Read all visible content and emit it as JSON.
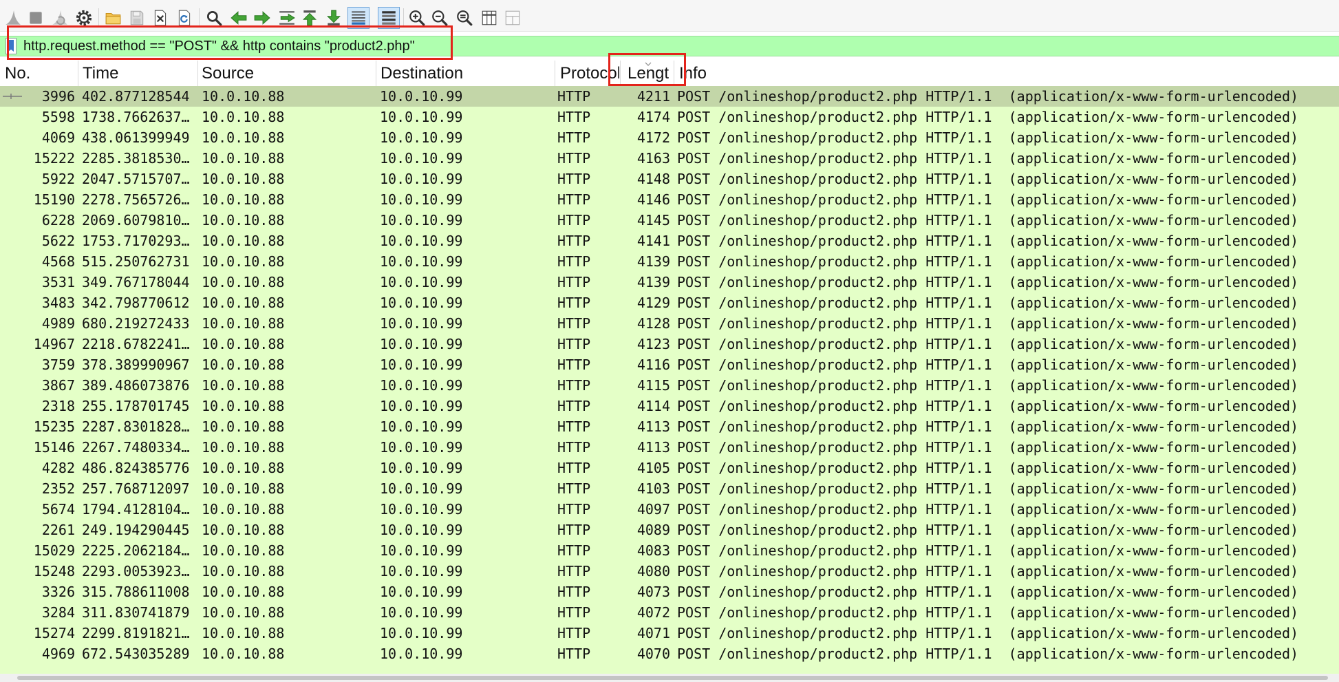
{
  "toolbar": {
    "buttons": [
      {
        "icon": "shark-fin-icon",
        "enabled": false
      },
      {
        "icon": "stop-icon",
        "enabled": false
      },
      {
        "icon": "restart-capture-icon",
        "enabled": false
      },
      {
        "icon": "capture-options-icon",
        "enabled": true
      },
      {
        "icon": "open-folder-icon",
        "enabled": true
      },
      {
        "icon": "save-icon",
        "enabled": false
      },
      {
        "icon": "close-file-icon",
        "enabled": true
      },
      {
        "icon": "reload-icon",
        "enabled": true
      },
      {
        "icon": "search-icon",
        "enabled": true
      },
      {
        "icon": "go-back-icon",
        "enabled": true
      },
      {
        "icon": "go-forward-icon",
        "enabled": true
      },
      {
        "icon": "go-to-packet-icon",
        "enabled": true
      },
      {
        "icon": "go-first-icon",
        "enabled": true
      },
      {
        "icon": "go-last-icon",
        "enabled": true
      },
      {
        "icon": "autoscroll-icon",
        "enabled": true,
        "checked": true
      },
      {
        "icon": "colorize-icon",
        "enabled": true,
        "checked": true
      },
      {
        "icon": "zoom-in-icon",
        "enabled": true
      },
      {
        "icon": "zoom-out-icon",
        "enabled": true
      },
      {
        "icon": "zoom-reset-icon",
        "enabled": true
      },
      {
        "icon": "resize-columns-icon",
        "enabled": true
      },
      {
        "icon": "layout-icon",
        "enabled": false
      }
    ]
  },
  "display_filter": {
    "value": "http.request.method == \"POST\" && http contains \"product2.php\"",
    "bookmark_icon": "bookmark-icon"
  },
  "columns": {
    "no": "No.",
    "time": "Time",
    "source": "Source",
    "destination": "Destination",
    "protocol": "Protocol",
    "length": "Length",
    "info": "Info"
  },
  "sort_indicator_icon": "chevron-down-icon",
  "selected_row": 0,
  "packets": [
    {
      "no": "3996",
      "time": "402.877128544",
      "source": "10.0.10.88",
      "destination": "10.0.10.99",
      "protocol": "HTTP",
      "length": "4211",
      "info": "POST /onlineshop/product2.php HTTP/1.1  (application/x-www-form-urlencoded)"
    },
    {
      "no": "5598",
      "time": "1738.7662637…",
      "source": "10.0.10.88",
      "destination": "10.0.10.99",
      "protocol": "HTTP",
      "length": "4174",
      "info": "POST /onlineshop/product2.php HTTP/1.1  (application/x-www-form-urlencoded)"
    },
    {
      "no": "4069",
      "time": "438.061399949",
      "source": "10.0.10.88",
      "destination": "10.0.10.99",
      "protocol": "HTTP",
      "length": "4172",
      "info": "POST /onlineshop/product2.php HTTP/1.1  (application/x-www-form-urlencoded)"
    },
    {
      "no": "15222",
      "time": "2285.3818530…",
      "source": "10.0.10.88",
      "destination": "10.0.10.99",
      "protocol": "HTTP",
      "length": "4163",
      "info": "POST /onlineshop/product2.php HTTP/1.1  (application/x-www-form-urlencoded)"
    },
    {
      "no": "5922",
      "time": "2047.5715707…",
      "source": "10.0.10.88",
      "destination": "10.0.10.99",
      "protocol": "HTTP",
      "length": "4148",
      "info": "POST /onlineshop/product2.php HTTP/1.1  (application/x-www-form-urlencoded)"
    },
    {
      "no": "15190",
      "time": "2278.7565726…",
      "source": "10.0.10.88",
      "destination": "10.0.10.99",
      "protocol": "HTTP",
      "length": "4146",
      "info": "POST /onlineshop/product2.php HTTP/1.1  (application/x-www-form-urlencoded)"
    },
    {
      "no": "6228",
      "time": "2069.6079810…",
      "source": "10.0.10.88",
      "destination": "10.0.10.99",
      "protocol": "HTTP",
      "length": "4145",
      "info": "POST /onlineshop/product2.php HTTP/1.1  (application/x-www-form-urlencoded)"
    },
    {
      "no": "5622",
      "time": "1753.7170293…",
      "source": "10.0.10.88",
      "destination": "10.0.10.99",
      "protocol": "HTTP",
      "length": "4141",
      "info": "POST /onlineshop/product2.php HTTP/1.1  (application/x-www-form-urlencoded)"
    },
    {
      "no": "4568",
      "time": "515.250762731",
      "source": "10.0.10.88",
      "destination": "10.0.10.99",
      "protocol": "HTTP",
      "length": "4139",
      "info": "POST /onlineshop/product2.php HTTP/1.1  (application/x-www-form-urlencoded)"
    },
    {
      "no": "3531",
      "time": "349.767178044",
      "source": "10.0.10.88",
      "destination": "10.0.10.99",
      "protocol": "HTTP",
      "length": "4139",
      "info": "POST /onlineshop/product2.php HTTP/1.1  (application/x-www-form-urlencoded)"
    },
    {
      "no": "3483",
      "time": "342.798770612",
      "source": "10.0.10.88",
      "destination": "10.0.10.99",
      "protocol": "HTTP",
      "length": "4129",
      "info": "POST /onlineshop/product2.php HTTP/1.1  (application/x-www-form-urlencoded)"
    },
    {
      "no": "4989",
      "time": "680.219272433",
      "source": "10.0.10.88",
      "destination": "10.0.10.99",
      "protocol": "HTTP",
      "length": "4128",
      "info": "POST /onlineshop/product2.php HTTP/1.1  (application/x-www-form-urlencoded)"
    },
    {
      "no": "14967",
      "time": "2218.6782241…",
      "source": "10.0.10.88",
      "destination": "10.0.10.99",
      "protocol": "HTTP",
      "length": "4123",
      "info": "POST /onlineshop/product2.php HTTP/1.1  (application/x-www-form-urlencoded)"
    },
    {
      "no": "3759",
      "time": "378.389990967",
      "source": "10.0.10.88",
      "destination": "10.0.10.99",
      "protocol": "HTTP",
      "length": "4116",
      "info": "POST /onlineshop/product2.php HTTP/1.1  (application/x-www-form-urlencoded)"
    },
    {
      "no": "3867",
      "time": "389.486073876",
      "source": "10.0.10.88",
      "destination": "10.0.10.99",
      "protocol": "HTTP",
      "length": "4115",
      "info": "POST /onlineshop/product2.php HTTP/1.1  (application/x-www-form-urlencoded)"
    },
    {
      "no": "2318",
      "time": "255.178701745",
      "source": "10.0.10.88",
      "destination": "10.0.10.99",
      "protocol": "HTTP",
      "length": "4114",
      "info": "POST /onlineshop/product2.php HTTP/1.1  (application/x-www-form-urlencoded)"
    },
    {
      "no": "15235",
      "time": "2287.8301828…",
      "source": "10.0.10.88",
      "destination": "10.0.10.99",
      "protocol": "HTTP",
      "length": "4113",
      "info": "POST /onlineshop/product2.php HTTP/1.1  (application/x-www-form-urlencoded)"
    },
    {
      "no": "15146",
      "time": "2267.7480334…",
      "source": "10.0.10.88",
      "destination": "10.0.10.99",
      "protocol": "HTTP",
      "length": "4113",
      "info": "POST /onlineshop/product2.php HTTP/1.1  (application/x-www-form-urlencoded)"
    },
    {
      "no": "4282",
      "time": "486.824385776",
      "source": "10.0.10.88",
      "destination": "10.0.10.99",
      "protocol": "HTTP",
      "length": "4105",
      "info": "POST /onlineshop/product2.php HTTP/1.1  (application/x-www-form-urlencoded)"
    },
    {
      "no": "2352",
      "time": "257.768712097",
      "source": "10.0.10.88",
      "destination": "10.0.10.99",
      "protocol": "HTTP",
      "length": "4103",
      "info": "POST /onlineshop/product2.php HTTP/1.1  (application/x-www-form-urlencoded)"
    },
    {
      "no": "5674",
      "time": "1794.4128104…",
      "source": "10.0.10.88",
      "destination": "10.0.10.99",
      "protocol": "HTTP",
      "length": "4097",
      "info": "POST /onlineshop/product2.php HTTP/1.1  (application/x-www-form-urlencoded)"
    },
    {
      "no": "2261",
      "time": "249.194290445",
      "source": "10.0.10.88",
      "destination": "10.0.10.99",
      "protocol": "HTTP",
      "length": "4089",
      "info": "POST /onlineshop/product2.php HTTP/1.1  (application/x-www-form-urlencoded)"
    },
    {
      "no": "15029",
      "time": "2225.2062184…",
      "source": "10.0.10.88",
      "destination": "10.0.10.99",
      "protocol": "HTTP",
      "length": "4083",
      "info": "POST /onlineshop/product2.php HTTP/1.1  (application/x-www-form-urlencoded)"
    },
    {
      "no": "15248",
      "time": "2293.0053923…",
      "source": "10.0.10.88",
      "destination": "10.0.10.99",
      "protocol": "HTTP",
      "length": "4080",
      "info": "POST /onlineshop/product2.php HTTP/1.1  (application/x-www-form-urlencoded)"
    },
    {
      "no": "3326",
      "time": "315.788611008",
      "source": "10.0.10.88",
      "destination": "10.0.10.99",
      "protocol": "HTTP",
      "length": "4073",
      "info": "POST /onlineshop/product2.php HTTP/1.1  (application/x-www-form-urlencoded)"
    },
    {
      "no": "3284",
      "time": "311.830741879",
      "source": "10.0.10.88",
      "destination": "10.0.10.99",
      "protocol": "HTTP",
      "length": "4072",
      "info": "POST /onlineshop/product2.php HTTP/1.1  (application/x-www-form-urlencoded)"
    },
    {
      "no": "15274",
      "time": "2299.8191821…",
      "source": "10.0.10.88",
      "destination": "10.0.10.99",
      "protocol": "HTTP",
      "length": "4071",
      "info": "POST /onlineshop/product2.php HTTP/1.1  (application/x-www-form-urlencoded)"
    },
    {
      "no": "4969",
      "time": "672.543035289",
      "source": "10.0.10.88",
      "destination": "10.0.10.99",
      "protocol": "HTTP",
      "length": "4070",
      "info": "POST /onlineshop/product2.php HTTP/1.1  (application/x-www-form-urlencoded)"
    }
  ],
  "colors": {
    "http_row": "#e4ffc7",
    "selected_row": "#c3d6a8",
    "filter_valid": "#afffaf",
    "annotation": "#e3241b"
  }
}
